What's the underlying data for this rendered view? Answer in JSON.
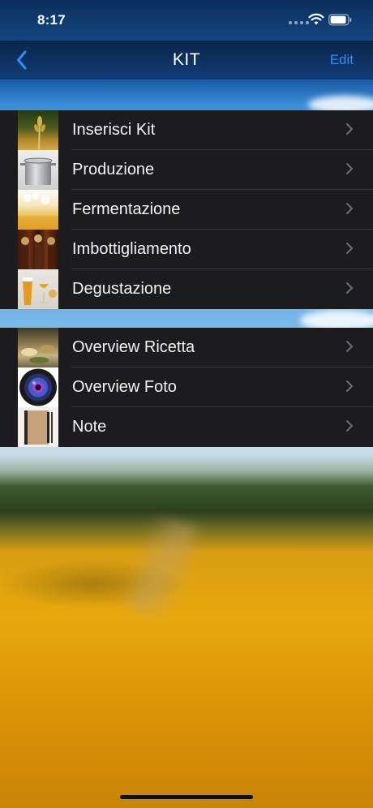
{
  "status_bar": {
    "time": "8:17"
  },
  "nav": {
    "title": "KIT",
    "edit_label": "Edit"
  },
  "section1": {
    "items": [
      {
        "label": "Inserisci Kit",
        "thumb": "wheat-photo"
      },
      {
        "label": "Produzione",
        "thumb": "stockpot-photo"
      },
      {
        "label": "Fermentazione",
        "thumb": "beer-foam-photo"
      },
      {
        "label": "Imbottigliamento",
        "thumb": "bottles-photo"
      },
      {
        "label": "Degustazione",
        "thumb": "beer-glasses-photo"
      }
    ]
  },
  "section2": {
    "items": [
      {
        "label": "Overview Ricetta",
        "thumb": "ingredients-photo"
      },
      {
        "label": "Overview Foto",
        "thumb": "camera-lens-photo"
      },
      {
        "label": "Note",
        "thumb": "notebook-photo"
      }
    ]
  },
  "colors": {
    "accent": "#2f8bff",
    "cell_background": "#1c1c1e"
  }
}
